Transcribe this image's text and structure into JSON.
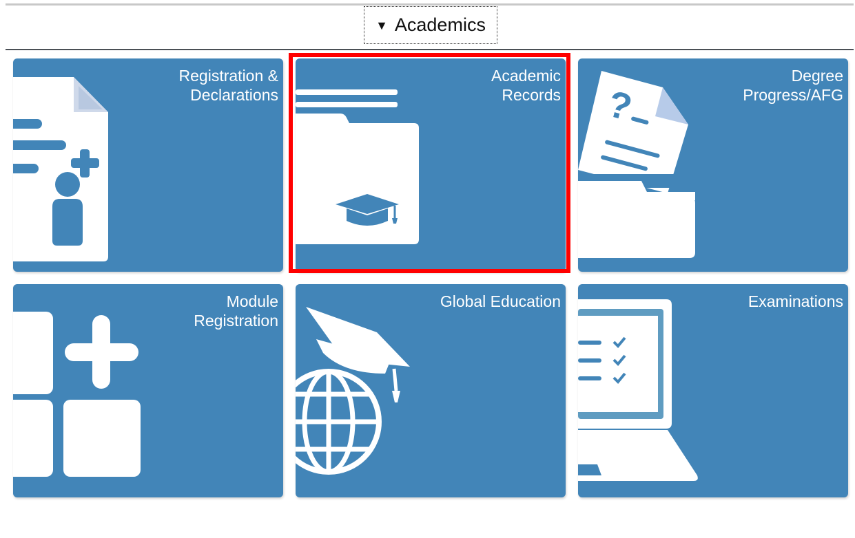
{
  "section": {
    "title": "Academics",
    "expanded": true
  },
  "colors": {
    "tile_bg": "#4285b8",
    "tile_text": "#ffffff",
    "highlight": "#ff0000"
  },
  "tiles": [
    {
      "label": "Registration &\nDeclarations",
      "icon": "document-person-add-icon"
    },
    {
      "label": "Academic\nRecords",
      "icon": "folder-graduation-cap-icon"
    },
    {
      "label": "Degree\nProgress/AFG",
      "icon": "document-question-folder-icon"
    },
    {
      "label": "Module\nRegistration",
      "icon": "grid-plus-icon"
    },
    {
      "label": "Global Education",
      "icon": "globe-graduation-cap-icon"
    },
    {
      "label": "Examinations",
      "icon": "laptop-checklist-icon"
    }
  ],
  "highlighted_tile": "Academic Records"
}
